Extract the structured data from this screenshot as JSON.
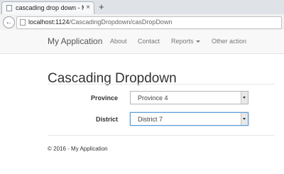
{
  "browser": {
    "tab_title": "cascading drop down - My...",
    "tab_close": "×",
    "new_tab": "+",
    "back": "←",
    "url_host": "localhost:1124",
    "url_path": "/CascadingDropdown/casDropDown"
  },
  "navbar": {
    "brand": "My Application",
    "about": "About",
    "contact": "Contact",
    "reports": "Reports",
    "other_action": "Other action"
  },
  "main": {
    "title": "Cascading Dropdown",
    "province_label": "Province",
    "province_value": "Province 4",
    "district_label": "District",
    "district_value": "District 7"
  },
  "footer": {
    "text": "© 2016 - My Application"
  }
}
